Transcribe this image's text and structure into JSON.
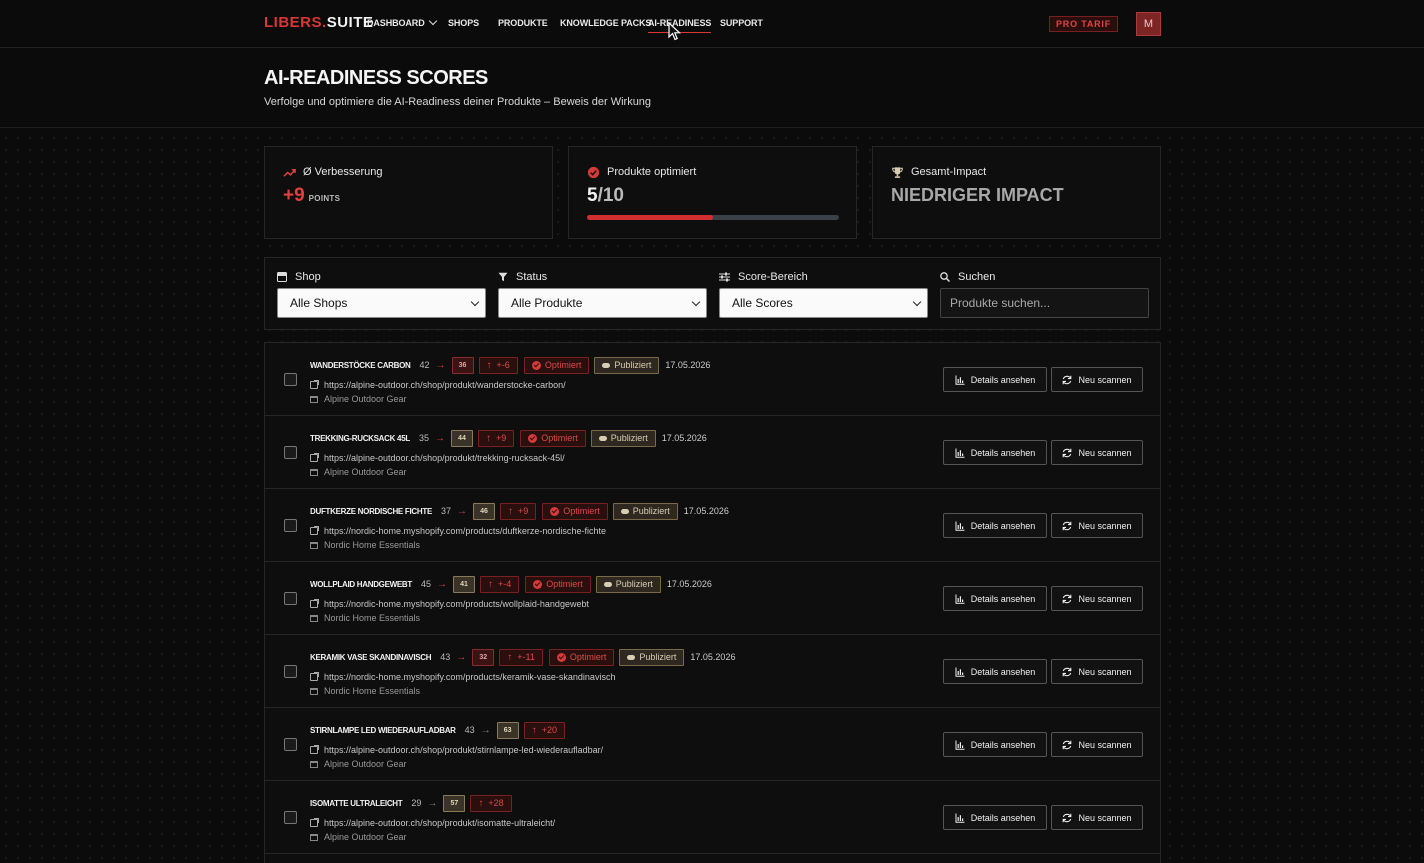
{
  "nav": {
    "logo_part1": "LIBERS",
    "logo_dot": ".",
    "logo_part2": "SUITE",
    "links": [
      "DASHBOARD",
      "SHOPS",
      "PRODUKTE",
      "KNOWLEDGE PACKS",
      "AI-READINESS",
      "SUPPORT"
    ],
    "active": "AI-READINESS",
    "plan_badge": "PRO TARIF",
    "avatar_initial": "M"
  },
  "header": {
    "title": "AI-READINESS SCORES",
    "subtitle": "Verfolge und optimiere die AI-Readiness deiner Produkte – Beweis der Wirkung"
  },
  "stats": {
    "improvement": {
      "label": "Ø Verbesserung",
      "value": "+9",
      "unit": "POINTS"
    },
    "optimized": {
      "label": "Produkte optimiert",
      "value_done": "5",
      "value_total": "/10",
      "progress": 0.5
    },
    "impact": {
      "label": "Gesamt-Impact",
      "value": "NIEDRIGER IMPACT"
    }
  },
  "filters": {
    "shop": {
      "label": "Shop",
      "value": "Alle Shops"
    },
    "status": {
      "label": "Status",
      "value": "Alle Produkte"
    },
    "score": {
      "label": "Score-Bereich",
      "value": "Alle Scores"
    },
    "search": {
      "label": "Suchen",
      "placeholder": "Produkte suchen..."
    }
  },
  "actions": {
    "details": "Details ansehen",
    "rescan": "Neu scannen"
  },
  "products": [
    {
      "name": "WANDERSTÖCKE CARBON",
      "old": "42",
      "new": "36",
      "new_style": "red",
      "arrow": "red",
      "delta": "+-6",
      "optimized": "Optimiert",
      "published": "Publiziert",
      "date": "17.05.2026",
      "url": "https://alpine-outdoor.ch/shop/produkt/wanderstocke-carbon/",
      "shop": "Alpine Outdoor Gear"
    },
    {
      "name": "TREKKING-RUCKSACK 45L",
      "old": "35",
      "new": "44",
      "new_style": "olive",
      "arrow": "red",
      "delta": "+9",
      "optimized": "Optimiert",
      "published": "Publiziert",
      "date": "17.05.2026",
      "url": "https://alpine-outdoor.ch/shop/produkt/trekking-rucksack-45l/",
      "shop": "Alpine Outdoor Gear"
    },
    {
      "name": "DUFTKERZE NORDISCHE FICHTE",
      "old": "37",
      "new": "46",
      "new_style": "olive",
      "arrow": "red",
      "delta": "+9",
      "optimized": "Optimiert",
      "published": "Publiziert",
      "date": "17.05.2026",
      "url": "https://nordic-home.myshopify.com/products/duftkerze-nordische-fichte",
      "shop": "Nordic Home Essentials"
    },
    {
      "name": "WOLLPLAID HANDGEWEBT",
      "old": "45",
      "new": "41",
      "new_style": "olive",
      "arrow": "red",
      "delta": "+-4",
      "optimized": "Optimiert",
      "published": "Publiziert",
      "date": "17.05.2026",
      "url": "https://nordic-home.myshopify.com/products/wollplaid-handgewebt",
      "shop": "Nordic Home Essentials"
    },
    {
      "name": "KERAMIK VASE SKANDINAVISCH",
      "old": "43",
      "new": "32",
      "new_style": "red",
      "arrow": "red",
      "delta": "+-11",
      "optimized": "Optimiert",
      "published": "Publiziert",
      "date": "17.05.2026",
      "url": "https://nordic-home.myshopify.com/products/keramik-vase-skandinavisch",
      "shop": "Nordic Home Essentials"
    },
    {
      "name": "STIRNLAMPE LED WIEDERAUFLADBAR",
      "old": "43",
      "new": "63",
      "new_style": "olive",
      "arrow": "grey",
      "delta": "+20",
      "optimized": "",
      "published": "",
      "date": "",
      "url": "https://alpine-outdoor.ch/shop/produkt/stirnlampe-led-wiederaufladbar/",
      "shop": "Alpine Outdoor Gear"
    },
    {
      "name": "ISOMATTE ULTRALEICHT",
      "old": "29",
      "new": "57",
      "new_style": "olive",
      "arrow": "grey",
      "delta": "+28",
      "optimized": "",
      "published": "",
      "date": "",
      "url": "https://alpine-outdoor.ch/shop/produkt/isomatte-ultraleicht/",
      "shop": "Alpine Outdoor Gear"
    }
  ],
  "colors": {
    "accent": "#d93636",
    "background": "#0b0b0b",
    "panel": "#0e0e0e",
    "olive_badge": "#3a3428"
  }
}
